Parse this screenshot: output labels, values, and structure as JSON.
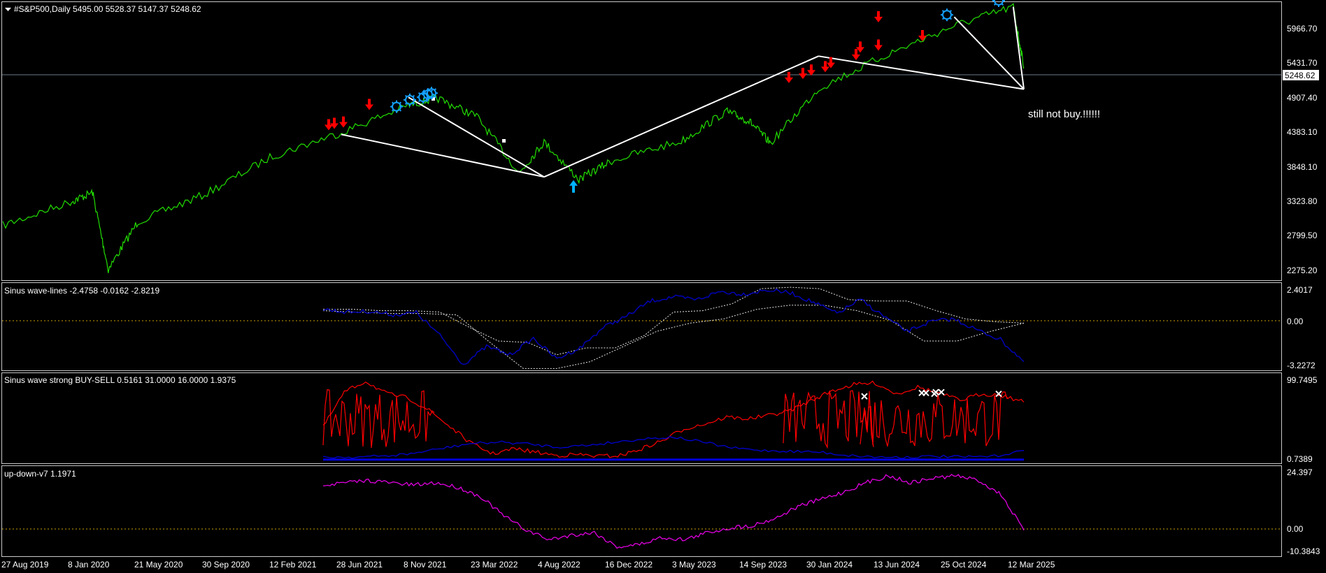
{
  "colors": {
    "background": "#000000",
    "frame": "#c8c8c8",
    "price": "#22dd00",
    "trend_line": "#ffffff",
    "sell_arrow": "#ff0000",
    "buy_arrow": "#00b4ff",
    "gear": "#14a0ff",
    "wave": "#0000cc",
    "envelope": "#e6e6e6",
    "zero_line": "#c8a000",
    "strong_red": "#ff0000",
    "strong_blue": "#0000dd",
    "updown": "#e000e0",
    "cross": "#ffffff",
    "price_tag_bg": "#ffffff",
    "price_tag_text": "#000000"
  },
  "main": {
    "header_icon": "dropdown-triangle-icon",
    "header": "#S&P500,Daily  5495.00 5528.37 5147.37 5248.62",
    "annotation": "still not buy.!!!!!!",
    "current_price": "5248.62",
    "y_labels": [
      "5966.70",
      "5431.70",
      "4907.40",
      "4383.10",
      "3848.10",
      "3323.80",
      "2799.50",
      "2275.20"
    ]
  },
  "panel1": {
    "header": "Sinus wave-lines -2.4758 -0.0162 -2.8219",
    "y_labels": [
      "2.4017",
      "0.00",
      "-3.2272"
    ]
  },
  "panel2": {
    "header": "Sinus wave strong BUY-SELL 0.5161 31.0000 16.0000 1.9375",
    "y_labels": [
      "99.7495",
      "0.7389"
    ]
  },
  "panel3": {
    "header": "up-down-v7 1.1971",
    "y_labels": [
      "24.397",
      "0.00",
      "-10.3843"
    ]
  },
  "x_labels": [
    "27 Aug 2019",
    "8 Jan 2020",
    "21 May 2020",
    "30 Sep 2020",
    "12 Feb 2021",
    "28 Jun 2021",
    "8 Nov 2021",
    "23 Mar 2022",
    "4 Aug 2022",
    "16 Dec 2022",
    "3 May 2023",
    "14 Sep 2023",
    "30 Jan 2024",
    "13 Jun 2024",
    "25 Oct 2024",
    "12 Mar 2025"
  ],
  "chart_data": [
    {
      "type": "line",
      "title": "#S&P500,Daily  5495.00 5528.37 5147.37 5248.62",
      "x": [
        "27 Aug 2019",
        "8 Jan 2020",
        "21 Feb 2020",
        "23 Mar 2020",
        "21 May 2020",
        "30 Sep 2020",
        "12 Feb 2021",
        "28 Jun 2021",
        "8 Nov 2021",
        "3 Jan 2022",
        "23 Mar 2022",
        "16 Jun 2022",
        "4 Aug 2022",
        "12 Oct 2022",
        "16 Dec 2022",
        "3 May 2023",
        "31 Jul 2023",
        "27 Oct 2023",
        "14 Sep 2023",
        "30 Jan 2024",
        "13 Jun 2024",
        "25 Oct 2024",
        "19 Feb 2025",
        "12 Mar 2025"
      ],
      "series": [
        {
          "values": [
            2900,
            3250,
            3390,
            2250,
            2960,
            3360,
            3930,
            4280,
            4680,
            4790,
            4520,
            3680,
            4140,
            3580,
            3860,
            4150,
            4590,
            4120,
            4450,
            4930,
            5430,
            5860,
            6140,
            5248.62
          ]
        }
      ],
      "ylim": [
        2100,
        6200
      ],
      "current_price": 5248.62,
      "trend_lines": [
        {
          "from": [
            "28 Jun 2021",
            4250
          ],
          "to": [
            "4 Aug 2022",
            3620
          ]
        },
        {
          "from": [
            "8 Nov 2021",
            4800
          ],
          "to": [
            "4 Aug 2022",
            3620
          ]
        },
        {
          "from": [
            "4 Aug 2022",
            3620
          ],
          "to": [
            "30 Jan 2024",
            5410
          ]
        },
        {
          "from": [
            "30 Jan 2024",
            5410
          ],
          "to": [
            "12 Mar 2025",
            4920
          ]
        },
        {
          "from": [
            "25 Oct 2024",
            5990
          ],
          "to": [
            "12 Mar 2025",
            4920
          ]
        },
        {
          "from": [
            "19 Feb 2025",
            6140
          ],
          "to": [
            "12 Mar 2025",
            4920
          ]
        }
      ],
      "sell_arrows": [
        4290,
        4310,
        4330,
        4590,
        4990,
        5050,
        5100,
        5150,
        5210,
        5330,
        5440,
        5470,
        5610,
        5890
      ],
      "buy_arrows": [
        3490
      ],
      "gears": [
        4620,
        4720,
        4760,
        4800,
        4820,
        5980,
        6190
      ]
    },
    {
      "type": "line",
      "title": "Sinus wave-lines -2.4758 -0.0162 -2.8219",
      "ylim": [
        -3.2272,
        2.4017
      ],
      "series": [
        {
          "values": [
            1.0,
            0.8,
            0.85,
            0.6,
            0.75,
            -0.9,
            -3.0,
            -1.7,
            -2.3,
            -1.1,
            -2.6,
            -1.8,
            -0.3,
            0.5,
            1.6,
            1.9,
            1.7,
            2.3,
            2.1,
            2.4,
            2.2,
            1.5,
            0.7,
            1.7,
            0.5,
            -0.6,
            0.1,
            0.3,
            -0.5,
            -1.2,
            -2.8
          ]
        },
        {
          "values": [
            1.0,
            1.0,
            0.9,
            0.9,
            0.8,
            -0.3,
            -1.3,
            -1.4,
            -2.3,
            -1.8,
            -1.8,
            -0.9,
            0.8,
            0.9,
            1.4,
            2.5,
            2.6,
            2.5,
            1.7,
            1.6,
            1.6,
            0.9,
            0.3,
            0.1,
            0.0
          ]
        },
        {
          "values": [
            0.9,
            0.8,
            0.7,
            0.7,
            0.6,
            -1.4,
            -3.3,
            -3.3,
            -2.8,
            -1.7,
            -0.6,
            0.0,
            0.3,
            1.0,
            1.3,
            1.3,
            0.9,
            0.2,
            -1.3,
            -1.3,
            -0.6,
            0.0
          ]
        }
      ]
    },
    {
      "type": "line",
      "title": "Sinus wave strong BUY-SELL 0.5161 31.0000 16.0000 1.9375",
      "ylim": [
        0.7389,
        99.7495
      ],
      "series": [
        {
          "values": [
            40,
            82,
            95,
            80,
            75,
            60,
            40,
            20,
            8,
            14,
            10,
            6,
            7,
            5,
            6,
            14,
            24,
            38,
            44,
            52,
            50,
            54,
            60,
            72,
            84,
            91,
            93,
            80,
            88,
            81,
            72,
            80,
            78,
            70
          ]
        },
        {
          "values": [
            4,
            4,
            5,
            8,
            14,
            20,
            22,
            20,
            16,
            18,
            22,
            26,
            28,
            22,
            15,
            12,
            11,
            10,
            6,
            4,
            4,
            5,
            4,
            5,
            12
          ]
        }
      ],
      "cross_markers": [
        77,
        81,
        81,
        80,
        82,
        82,
        80
      ]
    },
    {
      "type": "line",
      "title": "up-down-v7 1.1971",
      "ylim": [
        -10.3843,
        24.397
      ],
      "series": [
        {
          "values": [
            19,
            20,
            21,
            20,
            19,
            20,
            18,
            14,
            6,
            0,
            -4,
            -2,
            -1,
            -7,
            -6,
            -3,
            -4,
            -1,
            1,
            2,
            5,
            10,
            13,
            16,
            20,
            23,
            20,
            22,
            23,
            21,
            15,
            0
          ]
        }
      ]
    }
  ]
}
